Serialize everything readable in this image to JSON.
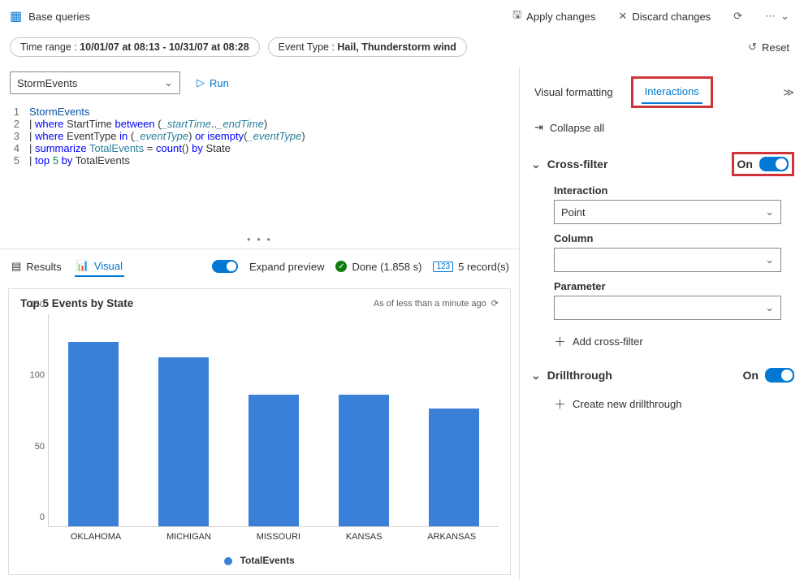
{
  "topbar": {
    "title": "Base queries",
    "apply": "Apply changes",
    "discard": "Discard changes"
  },
  "filters": {
    "time_range_label": "Time range : ",
    "time_range_value": "10/01/07 at 08:13 - 10/31/07 at 08:28",
    "event_type_label": "Event Type : ",
    "event_type_value": "Hail, Thunderstorm wind",
    "reset": "Reset"
  },
  "query": {
    "source": "StormEvents",
    "run": "Run",
    "lines": [
      {
        "n": "1",
        "raw": "StormEvents"
      },
      {
        "n": "2",
        "raw": "| where StartTime between (_startTime.._endTime)"
      },
      {
        "n": "3",
        "raw": "| where EventType in (_eventType) or isempty(_eventType)"
      },
      {
        "n": "4",
        "raw": "| summarize TotalEvents = count() by State"
      },
      {
        "n": "5",
        "raw": "| top 5 by TotalEvents"
      }
    ]
  },
  "results": {
    "tab_results": "Results",
    "tab_visual": "Visual",
    "expand_preview": "Expand preview",
    "done_label": "Done (1.858 s)",
    "records": "5 record(s)"
  },
  "chart_data": {
    "type": "bar",
    "title": "Top 5 Events by State",
    "as_of": "As of less than a minute ago",
    "legend": "TotalEvents",
    "ylim": [
      0,
      150
    ],
    "yticks": [
      0,
      50,
      100,
      150
    ],
    "categories": [
      "OKLAHOMA",
      "MICHIGAN",
      "MISSOURI",
      "KANSAS",
      "ARKANSAS"
    ],
    "values": [
      130,
      119,
      93,
      93,
      83
    ]
  },
  "panel": {
    "tab_visual_fmt": "Visual formatting",
    "tab_interactions": "Interactions",
    "collapse_all": "Collapse all",
    "crossfilter": {
      "title": "Cross-filter",
      "on": "On",
      "interaction_label": "Interaction",
      "interaction_value": "Point",
      "column_label": "Column",
      "column_value": "",
      "parameter_label": "Parameter",
      "parameter_value": "",
      "add": "Add cross-filter"
    },
    "drillthrough": {
      "title": "Drillthrough",
      "on": "On",
      "create": "Create new drillthrough"
    }
  }
}
